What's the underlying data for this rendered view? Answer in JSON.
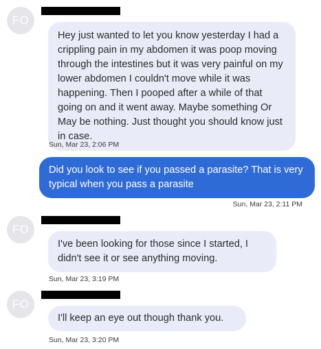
{
  "thread": {
    "messages": [
      {
        "direction": "incoming",
        "avatar_initials": "FO",
        "text": "Hey just wanted to let you know yesterday I had a crippling pain in my abdomen it was poop moving through the intestines but it was very painful on my lower abdomen I couldn't move while it was happening. Then I pooped after a while of that going on and it went away. Maybe something Or May be nothing. Just thought you should know just in case.",
        "timestamp": "Sun, Mar 23, 2:06 PM"
      },
      {
        "direction": "outgoing",
        "text": "Did you look to see if you passed a parasite? That is very typical when you pass a parasite",
        "timestamp": "Sun, Mar 23, 2:11 PM"
      },
      {
        "direction": "incoming",
        "avatar_initials": "FO",
        "text": "I've been looking for those since I started, I didn't see it or see anything moving.",
        "timestamp": "Sun, Mar 23, 3:19 PM"
      },
      {
        "direction": "incoming",
        "avatar_initials": "FO",
        "text": "I'll keep an eye out though thank you.",
        "timestamp": "Sun, Mar 23, 3:20 PM"
      }
    ]
  },
  "colors": {
    "incoming_bubble": "#e9ecf8",
    "outgoing_bubble": "#2f6bd7",
    "avatar": "#e5e5ea"
  }
}
